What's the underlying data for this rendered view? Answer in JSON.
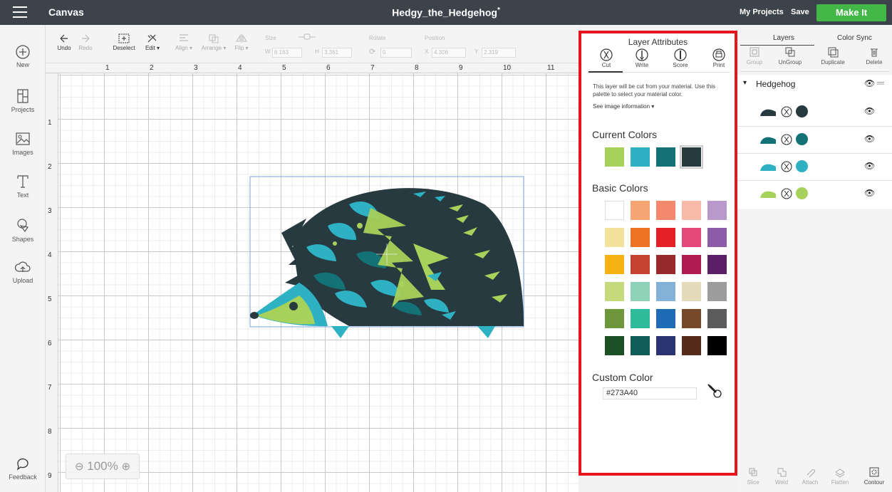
{
  "header": {
    "app_title": "Canvas",
    "document_title": "Hedgy_the_Hedgehog",
    "unsaved_marker": "*",
    "my_projects": "My Projects",
    "save": "Save",
    "make_it": "Make It"
  },
  "left_sidebar": {
    "items": [
      {
        "label": "New",
        "icon": "plus-circle-icon"
      },
      {
        "label": "Projects",
        "icon": "projects-icon"
      },
      {
        "label": "Images",
        "icon": "image-icon"
      },
      {
        "label": "Text",
        "icon": "text-icon"
      },
      {
        "label": "Shapes",
        "icon": "shapes-icon"
      },
      {
        "label": "Upload",
        "icon": "upload-icon"
      }
    ],
    "feedback": "Feedback"
  },
  "toolbar": {
    "undo": "Undo",
    "redo": "Redo",
    "deselect": "Deselect",
    "edit": "Edit",
    "align": "Align",
    "arrange": "Arrange",
    "flip": "Flip",
    "size_label": "Size",
    "w_label": "W",
    "w_value": "6.163",
    "h_label": "H",
    "h_value": "3.361",
    "rotate_label": "Rotate",
    "rotate_value": "0",
    "position_label": "Position",
    "x_label": "X",
    "x_value": "4.306",
    "y_label": "Y",
    "y_value": "2.319"
  },
  "canvas": {
    "ruler_top": [
      "1",
      "2",
      "3",
      "4",
      "5",
      "6",
      "7",
      "8",
      "9",
      "10",
      "11"
    ],
    "ruler_left": [
      "1",
      "2",
      "3",
      "4",
      "5",
      "6",
      "7",
      "8",
      "9"
    ],
    "zoom": "100%"
  },
  "layer_attributes": {
    "title": "Layer Attributes",
    "tabs": [
      "Cut",
      "Write",
      "Score",
      "Print"
    ],
    "description": "This layer will be cut from your material. Use this palette to select your material color.",
    "see_info": "See image information",
    "current_colors_title": "Current Colors",
    "current_colors": [
      "#a6d15a",
      "#2eb2c3",
      "#137275",
      "#273a40"
    ],
    "basic_colors_title": "Basic Colors",
    "basic_colors": [
      "#ffffff",
      "#f5a673",
      "#f5896e",
      "#f7b9a8",
      "#b998cc",
      "#f3e39a",
      "#ef7422",
      "#e32127",
      "#e44878",
      "#8b5ca7",
      "#f6b213",
      "#c3432f",
      "#992a2b",
      "#b01b52",
      "#5a1f66",
      "#c6d97d",
      "#8ed2b9",
      "#83b1d8",
      "#e3dbba",
      "#9c9c9c",
      "#6e963b",
      "#2dbb99",
      "#1f6bb6",
      "#76492a",
      "#5c5c5c",
      "#1c5024",
      "#105d58",
      "#2a3475",
      "#552c1a",
      "#000000"
    ],
    "custom_color_title": "Custom Color",
    "custom_color_value": "#273A40"
  },
  "right_panel": {
    "tabs": [
      "Layers",
      "Color Sync"
    ],
    "tools": [
      "Group",
      "UnGroup",
      "Duplicate",
      "Delete"
    ],
    "group_name": "Hedgehog",
    "layers": [
      {
        "color": "#273a40"
      },
      {
        "color": "#137275"
      },
      {
        "color": "#2eb2c3"
      },
      {
        "color": "#a6d15a"
      }
    ],
    "bottom_tools": [
      "Slice",
      "Weld",
      "Attach",
      "Flatten",
      "Contour"
    ]
  }
}
